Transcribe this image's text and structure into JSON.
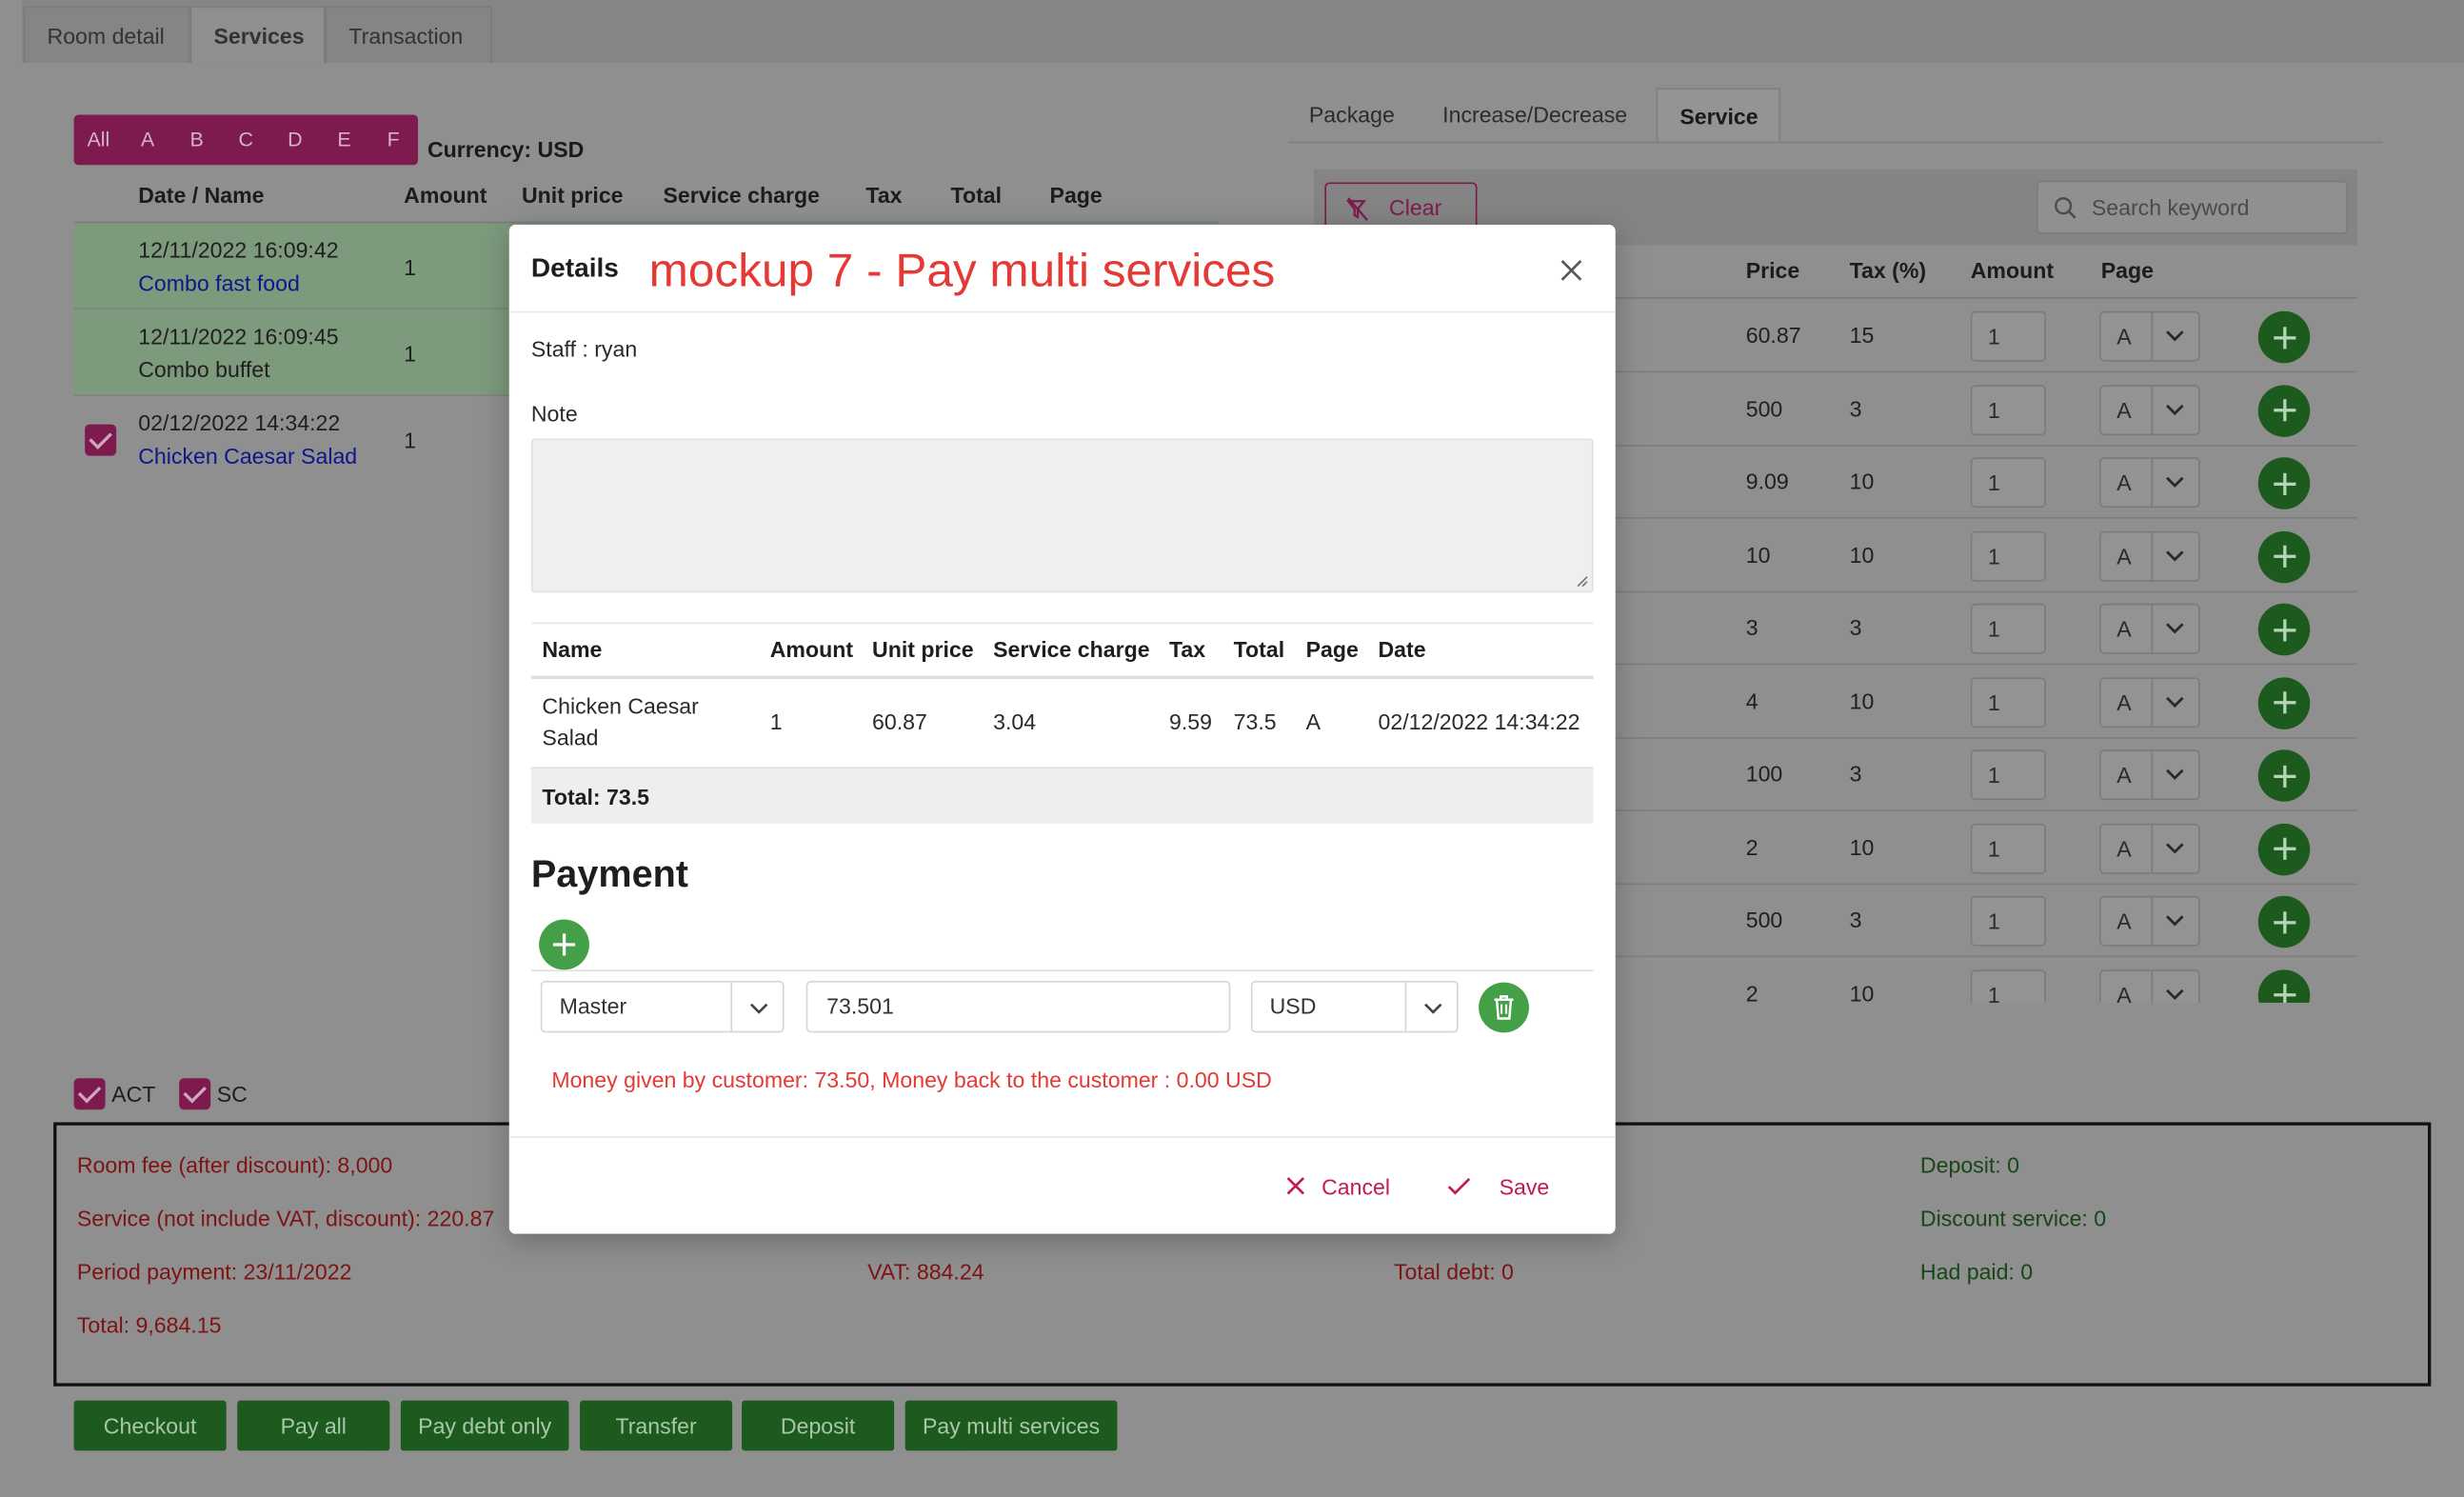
{
  "top_tabs": [
    "Room detail",
    "Services",
    "Transaction"
  ],
  "filters": [
    "All",
    "A",
    "B",
    "C",
    "D",
    "E",
    "F"
  ],
  "currency": "Currency: USD",
  "left_table": {
    "headers": [
      "Date / Name",
      "Amount",
      "Unit price",
      "Service charge",
      "Tax",
      "Total",
      "Page"
    ],
    "rows": [
      {
        "date": "12/11/2022 16:09:42",
        "name": "Combo fast food",
        "amount": "1"
      },
      {
        "date": "12/11/2022 16:09:45",
        "name": "Combo buffet",
        "amount": "1"
      },
      {
        "date": "02/12/2022 14:34:22",
        "name": "Chicken Caesar Salad",
        "amount": "1"
      }
    ]
  },
  "right_tabs": [
    "Package",
    "Increase/Decrease",
    "Service"
  ],
  "right_toolbar": {
    "clear_label": "Clear",
    "search_placeholder": "Search keyword"
  },
  "right_table": {
    "headers": [
      "Price",
      "Tax (%)",
      "Amount",
      "Page"
    ],
    "rows": [
      {
        "price": "60.87",
        "tax": "15",
        "amount": "1",
        "page": "A"
      },
      {
        "price": "500",
        "tax": "3",
        "amount": "1",
        "page": "A"
      },
      {
        "price": "9.09",
        "tax": "10",
        "amount": "1",
        "page": "A"
      },
      {
        "price": "10",
        "tax": "10",
        "amount": "1",
        "page": "A"
      },
      {
        "price": "3",
        "tax": "3",
        "amount": "1",
        "page": "A"
      },
      {
        "price": "4",
        "tax": "10",
        "amount": "1",
        "page": "A"
      },
      {
        "price": "100",
        "tax": "3",
        "amount": "1",
        "page": "A"
      },
      {
        "price": "2",
        "tax": "10",
        "amount": "1",
        "page": "A"
      },
      {
        "price": "500",
        "tax": "3",
        "amount": "1",
        "page": "A"
      },
      {
        "price": "2",
        "tax": "10",
        "amount": "1",
        "page": "A"
      }
    ]
  },
  "options": {
    "act": "ACT",
    "sc": "SC"
  },
  "summary": {
    "room_fee": "Room fee (after discount): 8,000",
    "service": "Service (not include VAT, discount): 220.87",
    "period": "Period payment: 23/11/2022",
    "total": "Total: 9,684.15",
    "vat": "VAT: 884.24",
    "total_debt": "Total debt: 0",
    "deposit": "Deposit: 0",
    "discount_service": "Discount service: 0",
    "had_paid": "Had paid: 0"
  },
  "bottom_buttons": [
    "Checkout",
    "Pay all",
    "Pay debt only",
    "Transfer",
    "Deposit",
    "Pay multi services"
  ],
  "modal": {
    "title": "Details",
    "mockup_label": "mockup 7 - Pay multi services",
    "staff": "Staff : ryan",
    "note_label": "Note",
    "note_value": "",
    "table_headers": [
      "Name",
      "Amount",
      "Unit price",
      "Service charge",
      "Tax",
      "Total",
      "Page",
      "Date"
    ],
    "table_row": {
      "name_line1": "Chicken Caesar",
      "name_line2": "Salad",
      "amount": "1",
      "unit_price": "60.87",
      "service_charge": "3.04",
      "tax": "9.59",
      "total": "73.5",
      "page": "A",
      "date": "02/12/2022 14:34:22"
    },
    "table_total": "Total: 73.5",
    "payment_title": "Payment",
    "payment": {
      "method": "Master",
      "amount": "73.501",
      "currency": "USD"
    },
    "message": "Money given by customer: 73.50, Money back to the customer : 0.00 USD",
    "cancel_label": "Cancel",
    "save_label": "Save"
  },
  "colors": {
    "accent_magenta": "#c2185b",
    "success_green": "#43a047",
    "error_red": "#e53935",
    "overlay_gray": "#8f8f8f"
  }
}
